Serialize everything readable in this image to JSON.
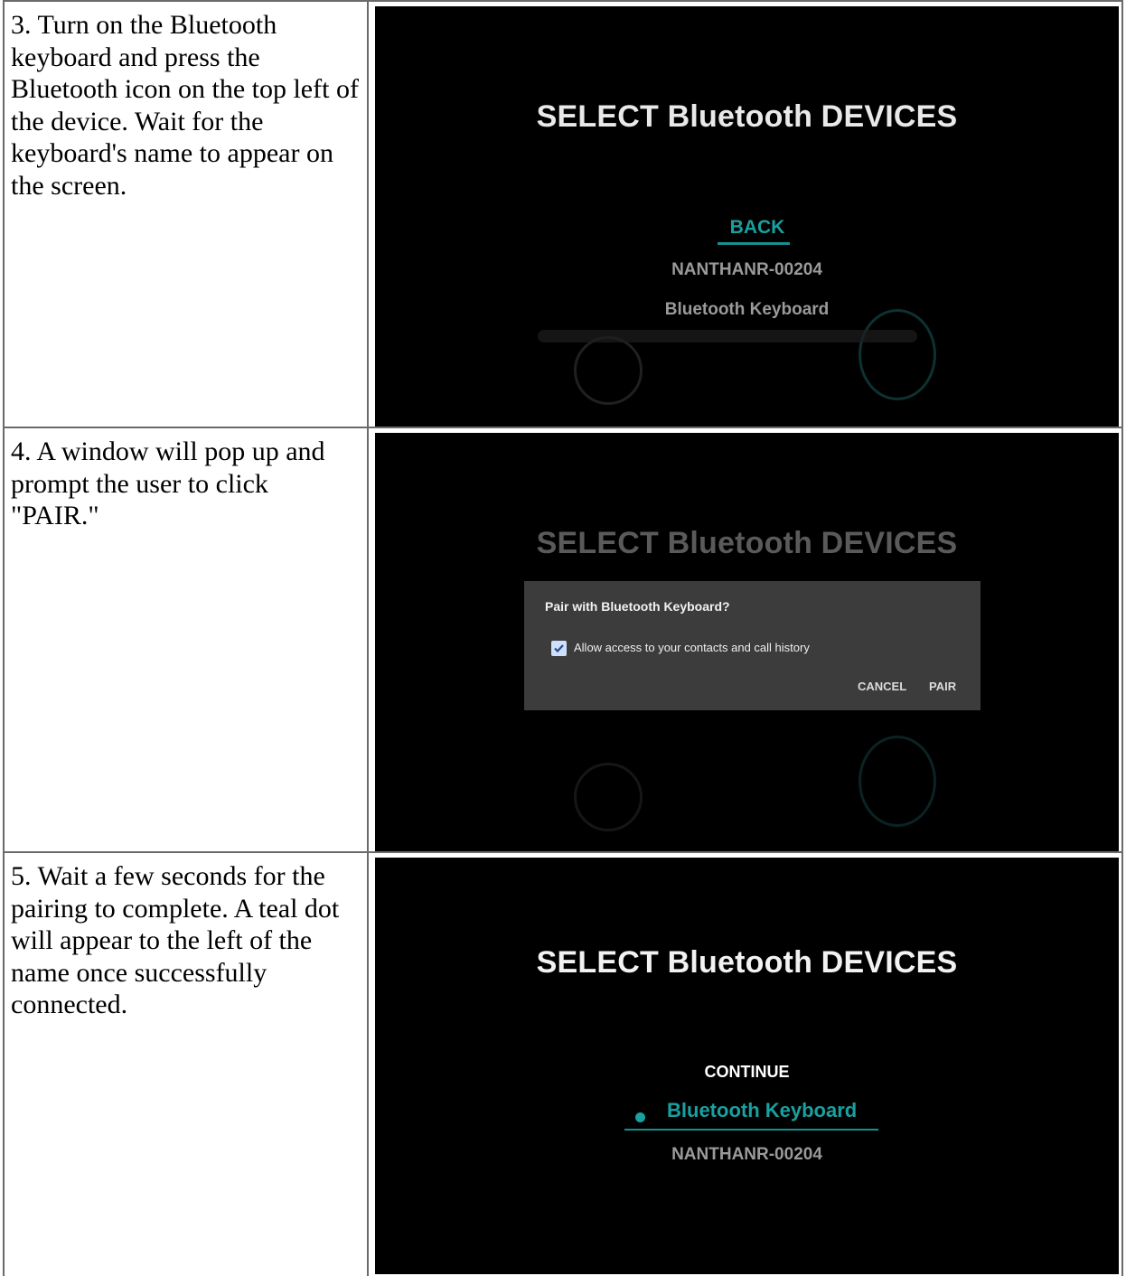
{
  "steps": [
    {
      "text": "3. Turn on the Bluetooth keyboard and press the Bluetooth icon on the top left of the device. Wait for the keyboard's name to appear on the screen.",
      "screen": {
        "title": "SELECT Bluetooth DEVICES",
        "back_label": "BACK",
        "devices": [
          "NANTHANR-00204",
          "Bluetooth Keyboard"
        ]
      }
    },
    {
      "text": "4. A window will pop up and prompt the user to click \"PAIR.\"",
      "screen": {
        "title": "SELECT Bluetooth DEVICES",
        "dialog": {
          "title": "Pair with Bluetooth Keyboard?",
          "checkbox_label": "Allow access to your contacts and call history",
          "checkbox_checked": true,
          "cancel_label": "CANCEL",
          "pair_label": "PAIR"
        }
      }
    },
    {
      "text": "5. Wait a few seconds for the pairing to complete. A teal dot will appear to the left of the name once successfully connected.",
      "screen": {
        "title": "SELECT Bluetooth DEVICES",
        "continue_label": "CONTINUE",
        "devices": [
          "Bluetooth Keyboard",
          "NANTHANR-00204"
        ],
        "connected_device_index": 0
      }
    }
  ],
  "colors": {
    "accent_teal": "#19a0a0",
    "screen_bg": "#000000",
    "dialog_bg": "#3c3c3c"
  }
}
